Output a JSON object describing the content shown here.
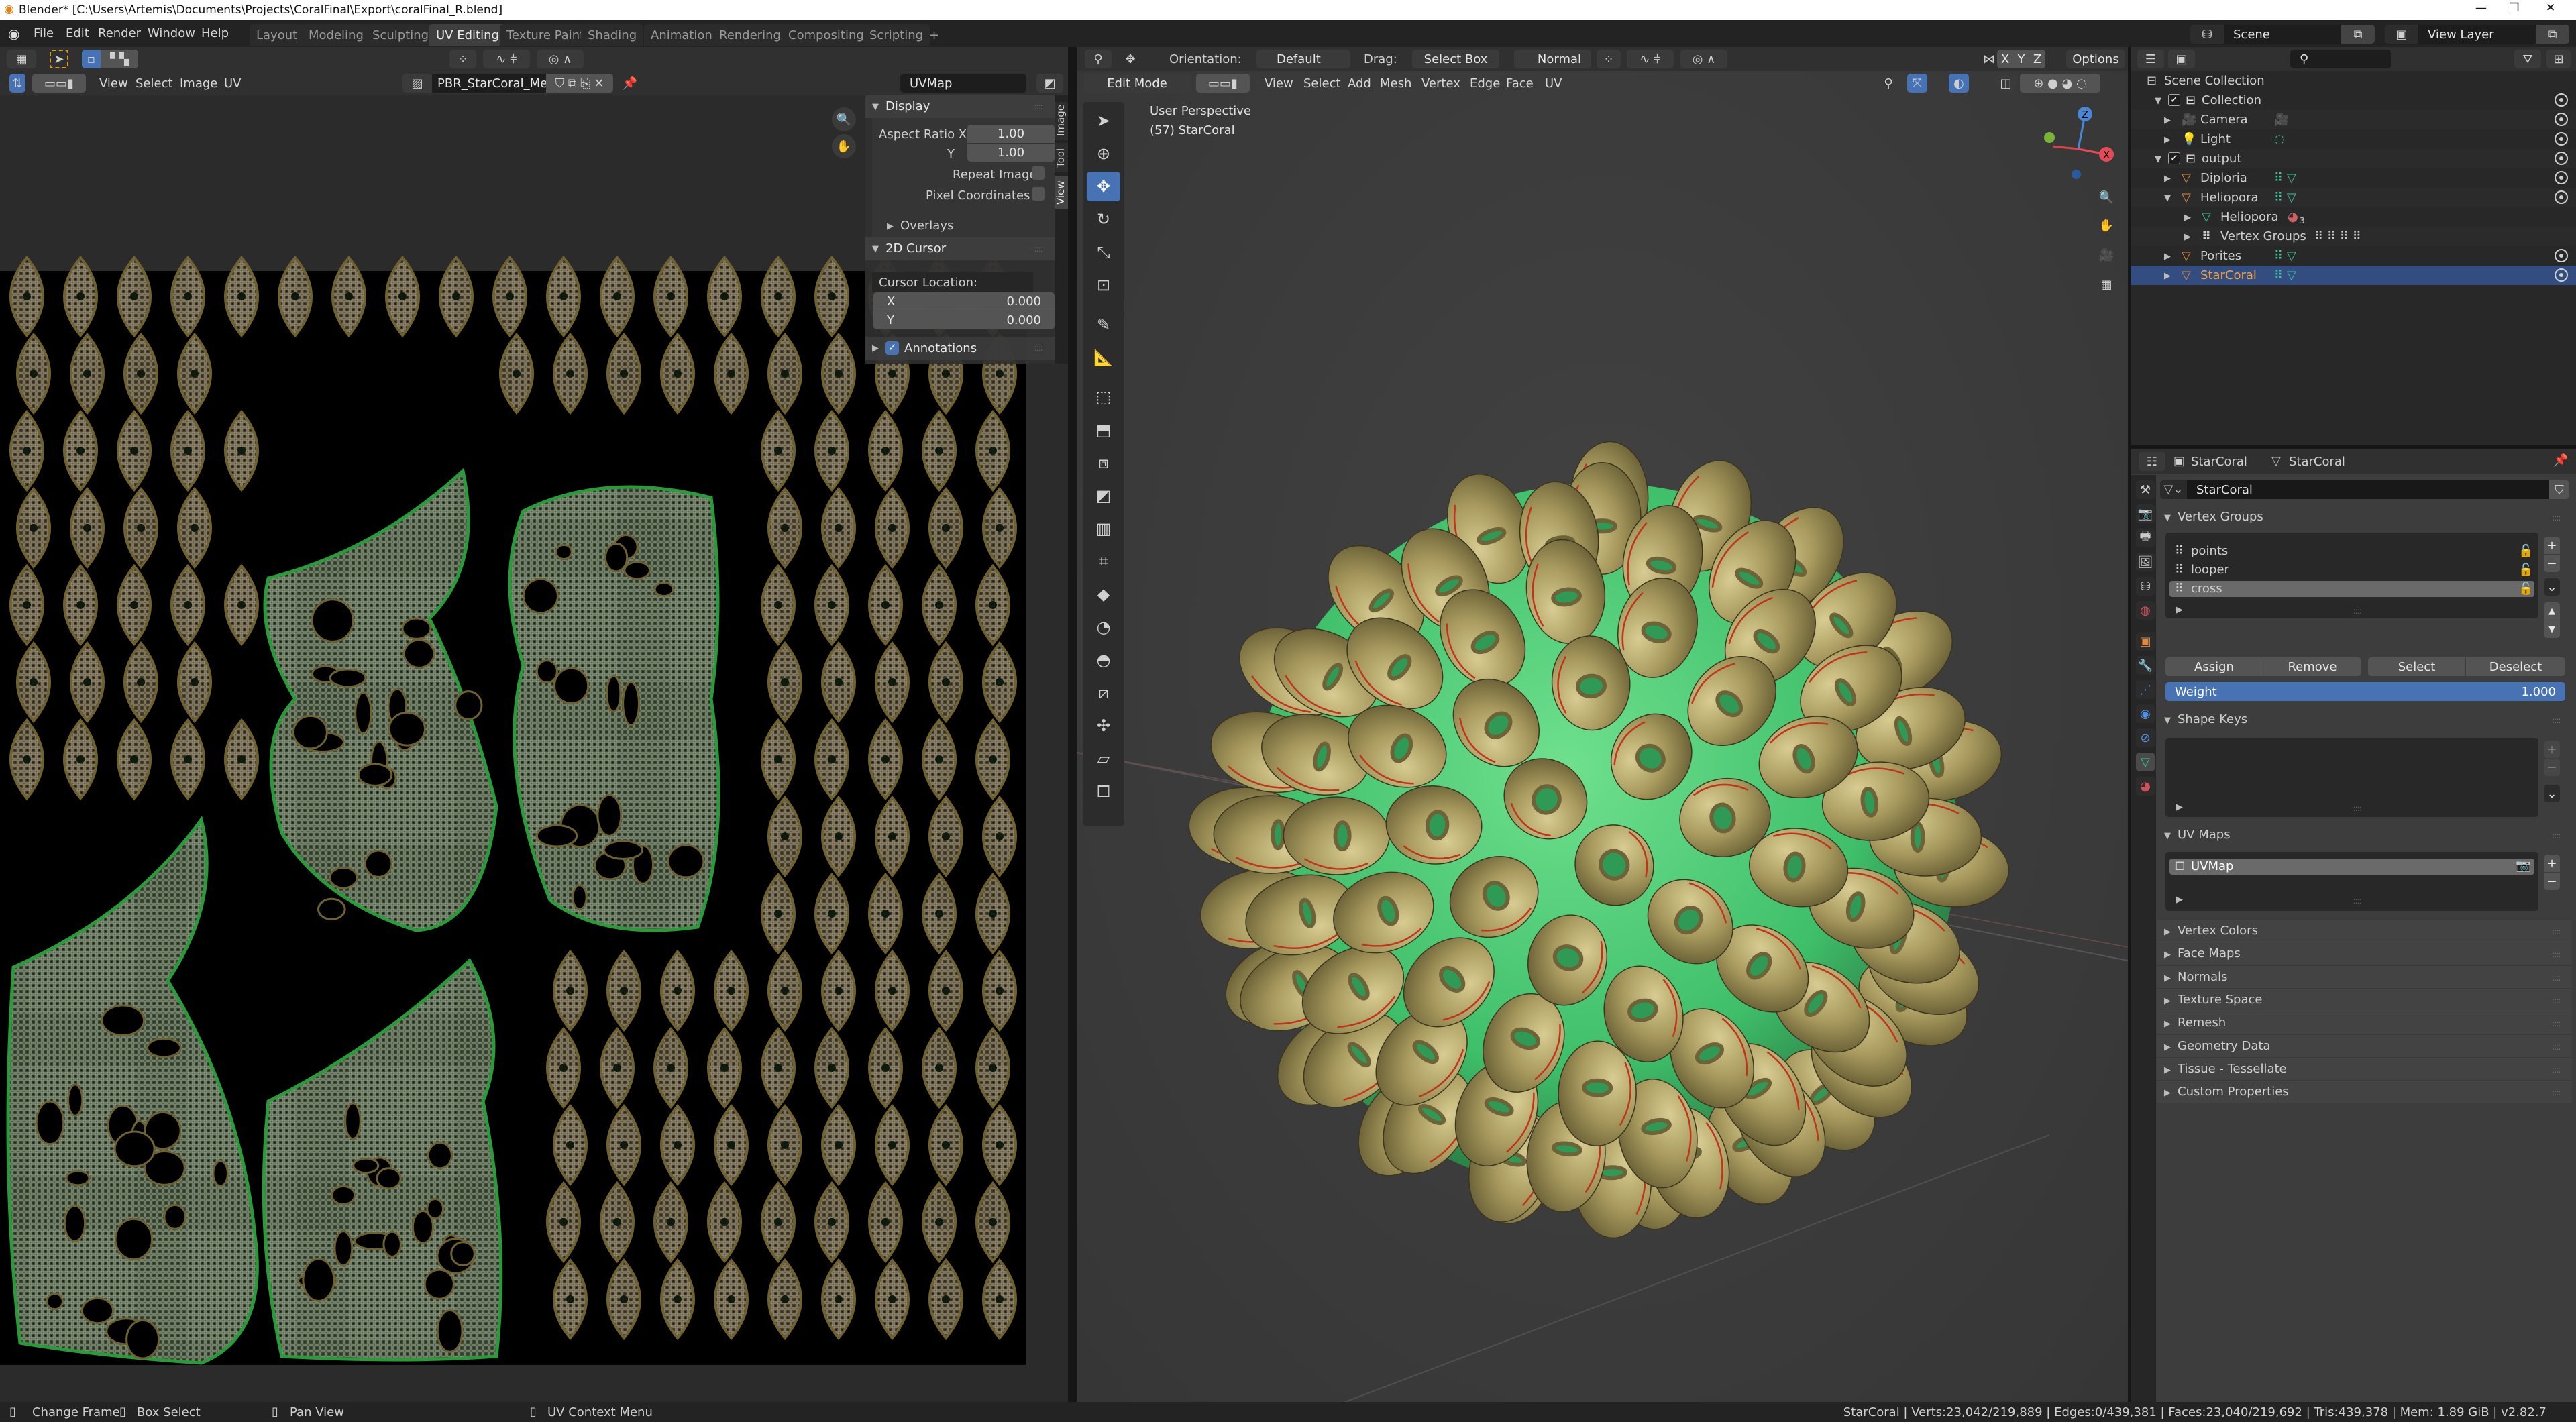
{
  "window": {
    "title": "Blender* [C:\\Users\\Artemis\\Documents\\Projects\\CoralFinal\\Export\\coralFinal_R.blend]"
  },
  "menu": [
    "File",
    "Edit",
    "Render",
    "Window",
    "Help"
  ],
  "workspaces": [
    "Layout",
    "Modeling",
    "Sculpting",
    "UV Editing",
    "Texture Paint",
    "Shading",
    "Animation",
    "Rendering",
    "Compositing",
    "Scripting",
    "+"
  ],
  "active_workspace": "UV Editing",
  "scene": {
    "scene": "Scene",
    "view_layer": "View Layer"
  },
  "uv_editor": {
    "menus": [
      "View",
      "Select",
      "Image",
      "UV"
    ],
    "image_name": "PBR_StarCoral_Met..",
    "uv_map": "UVMap",
    "sidebar_tabs": [
      "Image",
      "Tool",
      "View"
    ],
    "active_tab": "View",
    "display": {
      "header": "Display",
      "aspect_x_label": "Aspect Ratio X",
      "aspect_x": "1.00",
      "aspect_y_label": "Y",
      "aspect_y": "1.00",
      "repeat_image": "Repeat Image",
      "repeat_checked": false,
      "pixel_coords": "Pixel Coordinates",
      "pixel_checked": false,
      "overlays": "Overlays"
    },
    "cursor": {
      "header": "2D Cursor",
      "location_label": "Cursor Location:",
      "x_label": "X",
      "x": "0.000",
      "y_label": "Y",
      "y": "0.000"
    },
    "annotations": {
      "label": "Annotations",
      "checked": true
    }
  },
  "viewport": {
    "orientation_label": "Orientation:",
    "orientation": "Default",
    "drag_label": "Drag:",
    "drag": "Select Box",
    "pivot": "Normal",
    "axes": [
      "X",
      "Y",
      "Z"
    ],
    "options": "Options",
    "mode": "Edit Mode",
    "menus": [
      "View",
      "Select",
      "Add",
      "Mesh",
      "Vertex",
      "Edge",
      "Face",
      "UV"
    ],
    "perspective": "User Perspective",
    "object_info": "(57) StarCoral",
    "gizmo_axes": [
      "X",
      "Y",
      "Z"
    ],
    "colors": {
      "base": "#3fbf6a",
      "polyp": "#a89a5e",
      "seam": "#c0341e"
    }
  },
  "outliner": {
    "root": "Scene Collection",
    "rows": [
      {
        "label": "Collection",
        "depth": 0,
        "kind": "collection",
        "expanded": true,
        "checked": true
      },
      {
        "label": "Camera",
        "depth": 1,
        "kind": "camera"
      },
      {
        "label": "Light",
        "depth": 1,
        "kind": "light"
      },
      {
        "label": "output",
        "depth": 0,
        "kind": "collection",
        "expanded": true,
        "checked": true
      },
      {
        "label": "Diploria",
        "depth": 1,
        "kind": "mesh"
      },
      {
        "label": "Heliopora",
        "depth": 1,
        "kind": "mesh",
        "expanded": true
      },
      {
        "label": "Heliopora",
        "depth": 2,
        "kind": "mesh-data",
        "badge": "3"
      },
      {
        "label": "Vertex Groups",
        "depth": 2,
        "kind": "vertex-groups"
      },
      {
        "label": "Porites",
        "depth": 1,
        "kind": "mesh"
      },
      {
        "label": "StarCoral",
        "depth": 1,
        "kind": "mesh",
        "selected": true
      }
    ]
  },
  "properties": {
    "breadcrumb": [
      "StarCoral",
      "StarCoral"
    ],
    "mesh_name": "StarCoral",
    "vertex_groups": {
      "header": "Vertex Groups",
      "items": [
        "points",
        "looper",
        "cross"
      ],
      "active": "cross",
      "assign": "Assign",
      "remove": "Remove",
      "select": "Select",
      "deselect": "Deselect",
      "weight_label": "Weight",
      "weight": "1.000"
    },
    "shape_keys": {
      "header": "Shape Keys"
    },
    "uv_maps": {
      "header": "UV Maps",
      "items": [
        "UVMap"
      ]
    },
    "collapsed_panels": [
      "Vertex Colors",
      "Face Maps",
      "Normals",
      "Texture Space",
      "Remesh",
      "Geometry Data",
      "Tissue - Tessellate",
      "Custom Properties"
    ]
  },
  "statusbar": {
    "hints": [
      "Change Frame",
      "Box Select",
      "Pan View",
      "UV Context Menu"
    ],
    "stats": "StarCoral | Verts:23,042/219,889 | Edges:0/439,381 | Faces:23,040/219,692 | Tris:439,378 | Mem: 1.89 GiB | v2.82.7"
  }
}
